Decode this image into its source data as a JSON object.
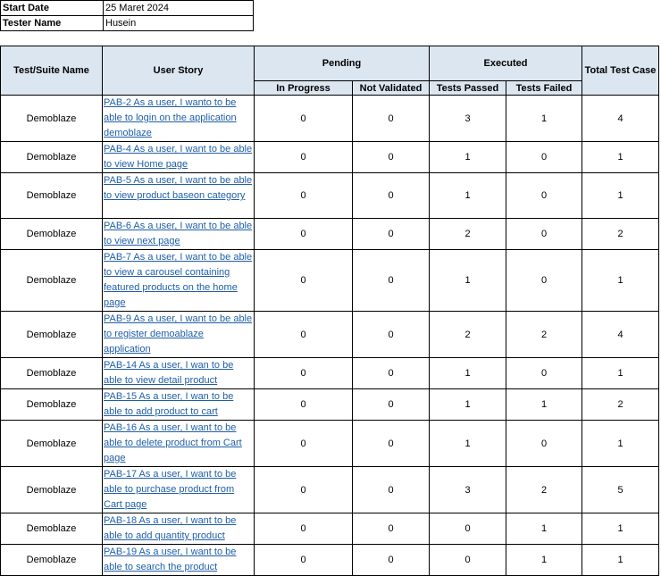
{
  "info": {
    "start_date_label": "Start Date",
    "start_date_value": "25 Maret 2024",
    "tester_label": "Tester Name",
    "tester_value": "Husein"
  },
  "headers": {
    "suite": "Test/Suite Name",
    "story": "User Story",
    "pending": "Pending",
    "executed": "Executed",
    "total": "Total Test Case",
    "in_progress": "In Progress",
    "not_validated": "Not Validated",
    "passed": "Tests Passed",
    "failed": "Tests Failed"
  },
  "link_color": "#1f5fa8",
  "header_bg": "#dce6f1",
  "rows": [
    {
      "suite": "Demoblaze",
      "story": "PAB-2 As a user, I wanto to be able to login on the application demoblaze",
      "in_progress": "0",
      "not_validated": "0",
      "passed": "3",
      "failed": "1",
      "total": "4"
    },
    {
      "suite": "Demoblaze",
      "story": "PAB-4 As a user, I want to be able to view Home page",
      "in_progress": "0",
      "not_validated": "0",
      "passed": "1",
      "failed": "0",
      "total": "1"
    },
    {
      "suite": "Demoblaze",
      "story": "PAB-5 As a user, I want to be able to view product baseon category",
      "in_progress": "0",
      "not_validated": "0",
      "passed": "1",
      "failed": "0",
      "total": "1"
    },
    {
      "suite": "Demoblaze",
      "story": "PAB-6 As a user, I want to be able to view next page",
      "in_progress": "0",
      "not_validated": "0",
      "passed": "2",
      "failed": "0",
      "total": "2"
    },
    {
      "suite": "Demoblaze",
      "story": "PAB-7 As a user, I want to be able to view a carousel containing featured products on the home page",
      "in_progress": "0",
      "not_validated": "0",
      "passed": "1",
      "failed": "0",
      "total": "1"
    },
    {
      "suite": "Demoblaze",
      "story": "PAB-9 As a user, I want to be able to register demoablaze application",
      "in_progress": "0",
      "not_validated": "0",
      "passed": "2",
      "failed": "2",
      "total": "4"
    },
    {
      "suite": "Demoblaze",
      "story": "PAB-14 As a user, I wan to be able to view detail product",
      "in_progress": "0",
      "not_validated": "0",
      "passed": "1",
      "failed": "0",
      "total": "1"
    },
    {
      "suite": "Demoblaze",
      "story": "PAB-15 As a user, I wan to be able to add product to cart",
      "in_progress": "0",
      "not_validated": "0",
      "passed": "1",
      "failed": "1",
      "total": "2"
    },
    {
      "suite": "Demoblaze",
      "story": "PAB-16 As a user, I want to be able to delete product from Cart page",
      "in_progress": "0",
      "not_validated": "0",
      "passed": "1",
      "failed": "0",
      "total": "1"
    },
    {
      "suite": "Demoblaze",
      "story": "PAB-17 As a user, I want to be able to purchase product from Cart page",
      "in_progress": "0",
      "not_validated": "0",
      "passed": "3",
      "failed": "2",
      "total": "5"
    },
    {
      "suite": "Demoblaze",
      "story": "PAB-18 As a user, I want to be able to add quantity product",
      "in_progress": "0",
      "not_validated": "0",
      "passed": "0",
      "failed": "1",
      "total": "1"
    },
    {
      "suite": "Demoblaze",
      "story": "PAB-19 As a user, I want to be able to search the product",
      "in_progress": "0",
      "not_validated": "0",
      "passed": "0",
      "failed": "1",
      "total": "1"
    }
  ]
}
